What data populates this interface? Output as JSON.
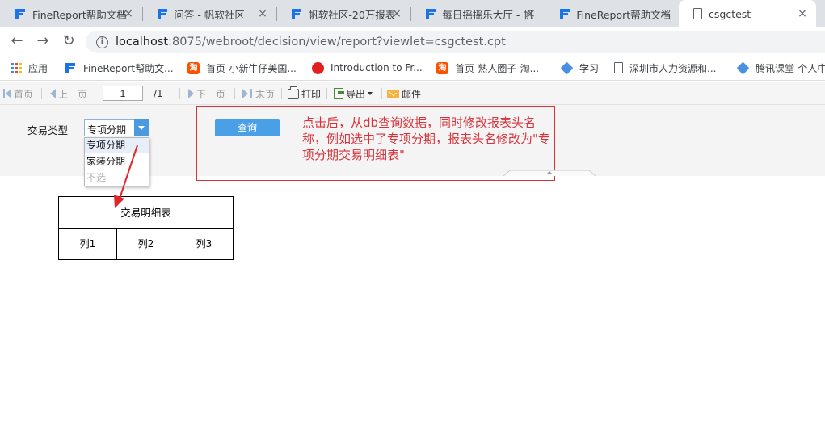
{
  "browser": {
    "tabs": [
      {
        "title": "FineReport帮助文档",
        "icon": "finereport-icon",
        "active": false
      },
      {
        "title": "问答 - 帆软社区",
        "icon": "finereport-icon",
        "active": false
      },
      {
        "title": "帆软社区-20万报表",
        "icon": "finereport-icon",
        "active": false
      },
      {
        "title": "每日摇摇乐大厅 - 帆",
        "icon": "finereport-icon",
        "active": false
      },
      {
        "title": "FineReport帮助文档",
        "icon": "finereport-icon",
        "active": false
      },
      {
        "title": "csgctest",
        "icon": "page-icon",
        "active": true
      }
    ],
    "url_host": "localhost",
    "url_rest": ":8075/webroot/decision/view/report?viewlet=csgctest.cpt",
    "bookmarks": [
      {
        "label": "应用",
        "icon": "apps-icon"
      },
      {
        "label": "FineReport帮助文...",
        "icon": "finereport-icon"
      },
      {
        "label": "首页-小新牛仔美国...",
        "icon": "taobao-icon"
      },
      {
        "label": "Introduction to Fr...",
        "icon": "red-circle-icon"
      },
      {
        "label": "首页-熟人圈子-淘...",
        "icon": "taobao-icon"
      },
      {
        "label": "学习",
        "icon": "diamond-icon"
      },
      {
        "label": "深圳市人力资源和...",
        "icon": "page-icon"
      },
      {
        "label": "腾讯课堂-个人中",
        "icon": "diamond-icon"
      }
    ]
  },
  "toolbar": {
    "first": "首页",
    "prev": "上一页",
    "page_current": "1",
    "page_total": "/1",
    "next": "下一页",
    "last": "末页",
    "print": "打印",
    "export": "导出",
    "mail": "邮件"
  },
  "params": {
    "label": "交易类型",
    "selected": "专项分期",
    "options": [
      "专项分期",
      "家装分期",
      "不选"
    ],
    "query_button": "查询"
  },
  "annotation": {
    "text": "点击后，从db查询数据，同时修改报表头名称，例如选中了专项分期，报表头名修改为\"专项分期交易明细表\"",
    "color": "#d7333a"
  },
  "report": {
    "title": "交易明细表",
    "columns": [
      "列1",
      "列2",
      "列3"
    ]
  }
}
